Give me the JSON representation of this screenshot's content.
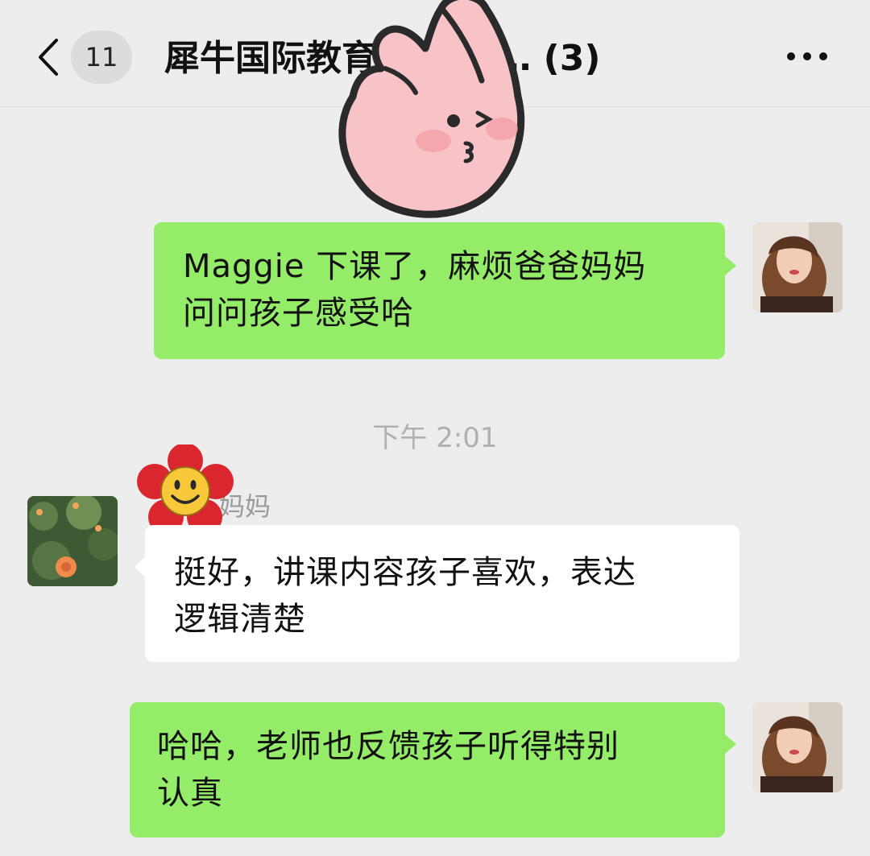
{
  "header": {
    "back_icon": "chevron-left-icon",
    "unread_count": "11",
    "title": "犀牛国际教育     伯学习…  (3)",
    "more_icon": "ellipsis-icon"
  },
  "messages": [
    {
      "direction": "out",
      "text_line1": "Maggie 下课了，麻烦爸爸妈妈",
      "text_line2": "问问孩子感受哈"
    },
    {
      "direction": "in",
      "sender": "妈妈",
      "text_line1": "挺好，讲课内容孩子喜欢，表达",
      "text_line2": "逻辑清楚"
    },
    {
      "direction": "out",
      "text_line1": "哈哈，老师也反馈孩子听得特别",
      "text_line2": "认真"
    }
  ],
  "timestamp": "下午 2:01",
  "stickers": [
    "pink-finger-heart-sticker",
    "smiley-flower-sticker"
  ],
  "colors": {
    "background": "#ededed",
    "outgoing_bubble": "#95ec69",
    "incoming_bubble": "#ffffff"
  }
}
